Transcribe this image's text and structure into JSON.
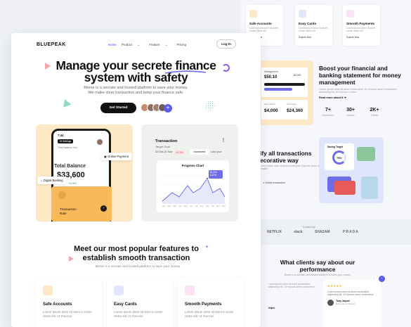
{
  "colors": {
    "accent": "#5b5be3",
    "brand_yellow": "#fde9c6",
    "orange": "#f8b95a",
    "green": "#2a9d5b",
    "red": "#e04e4e"
  },
  "front": {
    "brand": "BLUEPEAK",
    "nav": [
      "Home",
      "Product",
      "Feature",
      "Pricing"
    ],
    "login": "Log In",
    "hero_title": "Manage your secrete finance system with safety",
    "hero_sub": "Monie is a secrate and trusted platform to save your money. We make clear transaction and keep your finance safe.",
    "cta": "Get Started",
    "balance": {
      "time": "7:44",
      "settings": "Settings",
      "info": "Total balance Info",
      "title": "Total Balance",
      "value": "$33,600",
      "delta": "+5.4%",
      "online_payment": "Online Payment",
      "digital_banking": "Digital Banking",
      "tx_label_1": "Transaction",
      "tx_label_2": "Rate"
    },
    "transaction_card": {
      "title": "Transaction",
      "target": "Target Goal",
      "date": "22 Oct-21 Nov",
      "pct": "+5.3%",
      "increment": "Increment",
      "last_year": "Last year",
      "chart_title": "Progress Chart",
      "tooltip_val": "$1,200",
      "tooltip_pct": "5.42%",
      "months": [
        "Jan",
        "Feb",
        "Mar",
        "Apr",
        "May",
        "Jun",
        "Jul",
        "Aug",
        "Sep",
        "Oct",
        "Nov",
        "Dec"
      ]
    },
    "features_title": "Meet our most popular features to establish smooth transaction",
    "features_sub": "Monie is a secrate and trusted platform to save your money",
    "features": [
      {
        "title": "Safe Accounts",
        "desc": "Lorem ipsum dolor sit amet a conse ctetur elit. Ut rhoncus"
      },
      {
        "title": "Easy Cards",
        "desc": "Lorem ipsum dolor sit amet a conse ctetur elit. Ut rhoncus"
      },
      {
        "title": "Smooth Payments",
        "desc": "Lorem ipsum dolor sit amet a conse ctetur elit. Ut rhoncus"
      }
    ]
  },
  "back": {
    "feature_cards": [
      {
        "title": "Safe Accounts",
        "desc": "Lorem ipsum dolor sit amet conse ctetur elit",
        "more": "Explore Now"
      },
      {
        "title": "Easy Cards",
        "desc": "Lorem ipsum dolor sit amet conse ctetur elit",
        "more": "Explore Now"
      },
      {
        "title": "Smooth Payments",
        "desc": "Lorem ipsum dolor sit amet conse ctetur elit",
        "more": "Explore Now"
      }
    ],
    "boost_title": "Boost your financial and banking statement for money management",
    "boost_desc": "Lorem ipsum dolor sit amet consectetur. Ut rhoncus amet consectetur adipiscing elit. Ut rhoncus. Lorem",
    "boost_more": "Read more about it",
    "stats": [
      {
        "value": "7+",
        "label": "Experience"
      },
      {
        "value": "30+",
        "label": "Awards"
      },
      {
        "value": "2K+",
        "label": "Clients"
      }
    ],
    "panel1": {
      "values": [
        "$50.10",
        "$4,000",
        "$24,360",
        "$4,000"
      ],
      "management": "Management",
      "expenditure": "Expenditure",
      "upcoming": "Upcoming"
    },
    "simplify_title": "ify all transactions ecorative way",
    "simplify_desc": "Lorem ipsum dolor sit amet consectetur. Egestas vestib ulum aliquet fringilla",
    "online_tx": "Online transaction",
    "panel2": {
      "saving": "Saving Target",
      "pct": "75%"
    },
    "trusted": "Trusted by",
    "logos": [
      "NETFLIX",
      "slack",
      "SHAZAM",
      "PRADA"
    ],
    "clients_title": "What clients say about our performance",
    "clients_sub": "Monie is a secrate and trusted platform to save your money",
    "testimonial": "Lorem ipsum dolor sit amet consectetur adipiscing elit. Ut rhoncus amet consectetur",
    "testimonial_name": "Tony Jaquer",
    "testimonial_role": "Entrepreneur Anand",
    "helper": "lelper"
  }
}
